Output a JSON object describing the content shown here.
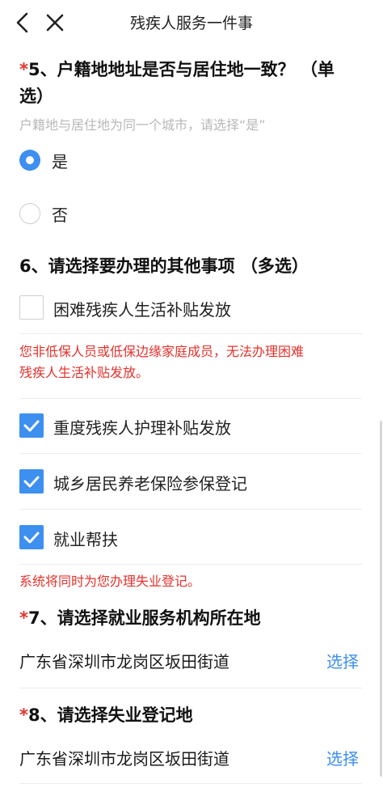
{
  "header": {
    "title": "残疾人服务一件事",
    "back_icon": "chevron-left-icon",
    "close_icon": "close-icon"
  },
  "q5": {
    "star": "*",
    "title_line1": "5、户籍地地址是否与居住地一致？ （单",
    "title_line2": "选）",
    "hint": "户籍地与居住地为同一个城市，请选择“是”",
    "options": [
      {
        "label": "是",
        "selected": true
      },
      {
        "label": "否",
        "selected": false
      }
    ]
  },
  "q6": {
    "title": "6、请选择要办理的其他事项 （多选）",
    "options": [
      {
        "label": "困难残疾人生活补贴发放",
        "checked": false
      },
      {
        "label": "重度残疾人护理补贴发放",
        "checked": true
      },
      {
        "label": "城乡居民养老保险参保登记",
        "checked": true
      },
      {
        "label": "就业帮扶",
        "checked": true
      }
    ],
    "warning_line1": "您非低保人员或低保边缘家庭成员，无法办理困难",
    "warning_line2": "残疾人生活补贴发放。",
    "notice": "系统将同时为您办理失业登记。"
  },
  "q7": {
    "star": "*",
    "title": "7、请选择就业服务机构所在地",
    "value": "广东省深圳市龙岗区坂田街道",
    "action": "选择"
  },
  "q8": {
    "star": "*",
    "title": "8、请选择失业登记地",
    "value": "广东省深圳市龙岗区坂田街道",
    "action": "选择"
  },
  "colors": {
    "accent": "#3d8ff0",
    "required_star": "#e5312b",
    "warning": "#e5312b",
    "hint": "#b8b8b8"
  }
}
